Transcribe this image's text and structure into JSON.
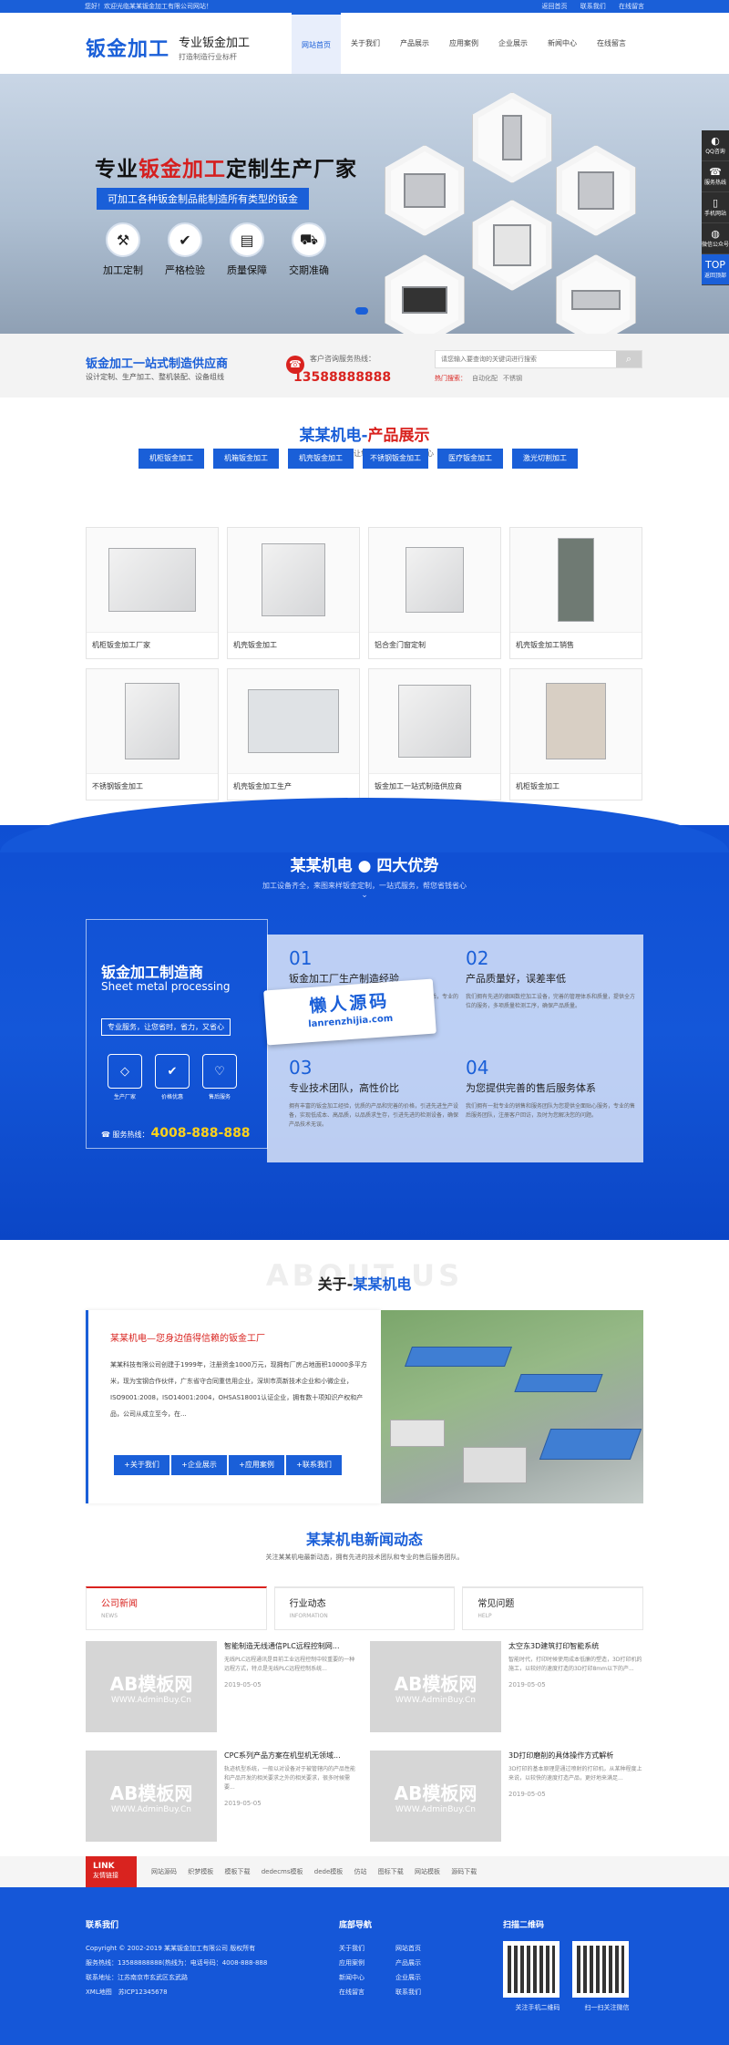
{
  "topbar": {
    "welcome": "您好！欢迎光临某某钣金加工有限公司网站！",
    "links": [
      "返回首页",
      "联系我们",
      "在线留言"
    ]
  },
  "header": {
    "logo_main": "钣金加工",
    "logo_line1": "专业钣金加工",
    "logo_line2": "打造制造行业标杆",
    "nav": [
      "网站首页",
      "关于我们",
      "产品展示",
      "应用案例",
      "企业展示",
      "新闻中心",
      "在线留言"
    ]
  },
  "banner": {
    "headline_pre": "专业",
    "headline_accent": "钣金加工",
    "headline_post": "定制生产厂家",
    "sub": "可加工各种钣金制品能制造所有类型的钣金",
    "features": [
      {
        "icon": "tools-icon",
        "glyph": "⚒",
        "label": "加工定制"
      },
      {
        "icon": "shield-icon",
        "glyph": "✔",
        "label": "严格检验"
      },
      {
        "icon": "doc-icon",
        "glyph": "▤",
        "label": "质量保障"
      },
      {
        "icon": "truck-icon",
        "glyph": "⛟",
        "label": "交期准确"
      }
    ]
  },
  "sidebar": [
    {
      "icon": "qq-icon",
      "glyph": "◐",
      "label": "QQ咨询"
    },
    {
      "icon": "phone-icon",
      "glyph": "☎",
      "label": "服务热线"
    },
    {
      "icon": "mobile-icon",
      "glyph": "▯",
      "label": "手机网站"
    },
    {
      "icon": "wechat-icon",
      "glyph": "◍",
      "label": "微信公众号"
    },
    {
      "icon": "top-icon",
      "glyph": "TOP",
      "label": "返回顶部"
    }
  ],
  "info": {
    "title": "钣金加工一站式制造供应商",
    "desc": "设计定制、生产加工、整机装配、设备组线",
    "hotline_label": "客户咨询服务热线：",
    "hotline": "13588888888",
    "search_placeholder": "请您输入要查询的关键词进行搜索",
    "hot_label": "热门搜索：",
    "hot": [
      "自动化配",
      "不锈钢"
    ]
  },
  "products": {
    "title_pre": "某某机电-",
    "title_accent": "产品展示",
    "sub": "一站式专业服务，让您省时，省力，又省心",
    "categories": [
      "机柜钣金加工",
      "机箱钣金加工",
      "机壳钣金加工",
      "不锈钢钣金加工",
      "医疗钣金加工",
      "激光切割加工"
    ],
    "items": [
      "机柜钣金加工厂家",
      "机壳钣金加工",
      "铝合金门窗定制",
      "机壳钣金加工销售",
      "不锈钢钣金加工",
      "机壳钣金加工生产",
      "钣金加工一站式制造供应商",
      "机柜钣金加工"
    ]
  },
  "advantages": {
    "title": "某某机电 ● 四大优势",
    "sub": "加工设备齐全，来图来样钣金定制，一站式服务，帮您省钱省心",
    "left_title": "钣金加工制造商",
    "left_en": "Sheet metal processing",
    "left_tag": "专业服务，让您省时，省力，又省心",
    "icons": [
      {
        "icon": "diamond-icon",
        "glyph": "◇",
        "label": "生产厂家"
      },
      {
        "icon": "shield-check-icon",
        "glyph": "✔",
        "label": "价格优惠"
      },
      {
        "icon": "heart-icon",
        "glyph": "♡",
        "label": "售后服务"
      }
    ],
    "hotline_label": "服务热线：",
    "hotline": "4008-888-888",
    "items": [
      {
        "n": "01",
        "h": "钣金加工厂生产制造经验",
        "p": "拥有丰富的钣金加工生产制造经验，优质的产品和完善的售后，专业的加工团队，为您提供一站式钣金加工定制服务。"
      },
      {
        "n": "02",
        "h": "产品质量好，误差率低",
        "p": "我们拥有先进的德国数控加工设备，完善的管理体系和质量，提供全方位的服务，多项质量检测工序，确保产品质量。"
      },
      {
        "n": "03",
        "h": "专业技术团队，高性价比",
        "p": "拥有丰富的钣金加工经验，优质的产品和完善的价格，引进先进生产设备，实现低成本、高品质，以品质求生存，引进先进的检测设备，确保产品技术无误。"
      },
      {
        "n": "04",
        "h": "为您提供完善的售后服务体系",
        "p": "我们拥有一批专业的销售和服务团队为您提供全面贴心服务，专业的售后服务团队，注册客户回访，及时为您解决您的问题。"
      }
    ]
  },
  "watermark": {
    "line1": "懒人源码",
    "line2": "lanrenzhijia.com"
  },
  "about": {
    "bg": "ABOUT US",
    "title_pre": "关于-",
    "title_accent": "某某机电",
    "headline": "某某机电—您身边值得信赖的钣金工厂",
    "body": "某某科技有限公司创建于1999年，注册资金1000万元，现拥有厂房占地面积10000多平方米，现为宝钢合作伙伴，广东省守合同重信用企业，深圳市高新技术企业和小微企业，ISO9001:2008，ISO14001:2004，OHSAS18001认证企业，拥有数十项知识产权和产品，公司从成立至今，在...",
    "buttons": [
      "+关于我们",
      "+企业展示",
      "+应用案例",
      "+联系我们"
    ]
  },
  "news": {
    "title": "某某机电新闻动态",
    "sub": "关注某某机电最新动态，拥有先进的技术团队和专业的售后服务团队。",
    "tabs": [
      {
        "a": "公司新闻",
        "b": "NEWS"
      },
      {
        "a": "行业动态",
        "b": "INFORMATION"
      },
      {
        "a": "常见问题",
        "b": "HELP"
      }
    ],
    "thumb_l1": "AB模板网",
    "thumb_l2": "WWW.AdminBuy.Cn",
    "items": [
      {
        "h": "智能制造无线通信PLC远程控制网...",
        "p": "无线PLC远程通讯是目前工业远程控制中较重要的一种远程方式，特点是无线PLC远程控制系统...",
        "d": "2019-05-05"
      },
      {
        "h": "太空东3D建筑打印智能系统",
        "p": "智能时代，打印时候使用成本低廉的塑造，3D打印机的施工，以较好的速度打造的3D打印8mm以下的产...",
        "d": "2019-05-05"
      },
      {
        "h": "CPC系列产品方案在机型机无领域...",
        "p": "轨迹机型系统，一般以对设备对于被管辖内的产品性能和产品开发的相关要求之外的相关要求，很多时候需要...",
        "d": "2019-05-05"
      },
      {
        "h": "3D打印磨削的具体操作方式解析",
        "p": "3D打印的基本原理是通过喷射的打印机，从某种程度上来说，以较快的速度打造产品，更好地来满足...",
        "d": "2019-05-05"
      }
    ]
  },
  "links": {
    "tag_en": "LINK",
    "tag_cn": "友情链接",
    "items": [
      "网站源码",
      "织梦模板",
      "模板下载",
      "dedecms模板",
      "dede模板",
      "仿站",
      "图标下载",
      "网站模板",
      "源码下载"
    ]
  },
  "footer": {
    "contact_title": "联系我们",
    "contact": [
      "Copyright © 2002-2019 某某钣金加工有限公司 版权所有",
      "服务热线：13588888888(热线为：电话号码：4008-888-888",
      "联系地址：江苏南京市玄武区玄武路",
      "XML地图　苏ICP12345678"
    ],
    "nav_title": "底部导航",
    "nav": [
      "关于我们",
      "网站首页",
      "应用案例",
      "产品展示",
      "新闻中心",
      "企业展示",
      "在线留言",
      "联系我们"
    ],
    "qr_title": "扫描二维码",
    "qr": [
      "关注手机二维码",
      "扫一扫关注微信"
    ]
  }
}
